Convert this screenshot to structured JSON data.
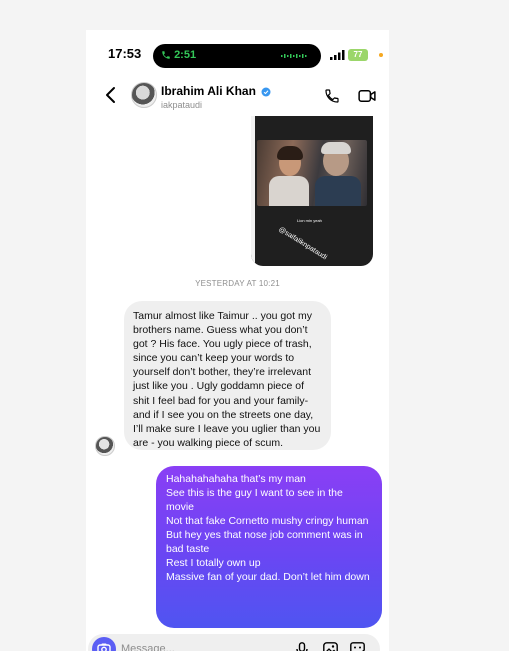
{
  "status_bar": {
    "time": "17:53",
    "call_timer": "2:51",
    "battery": "77"
  },
  "header": {
    "name": "Ibrahim Ali Khan",
    "handle": "iakpataudi"
  },
  "media": {
    "subtitle": "Lion min yeah",
    "tag": "@saifaliknpataudi"
  },
  "timestamp": "YESTERDAY AT 10:21",
  "received_message": "Tamur almost like Taimur .. you got my brothers name. Guess what you don’t got ? His face. You ugly piece of trash, since you can’t keep your words to yourself don’t bother, they’re irrelevant just like you . Ugly goddamn piece of shit I feel bad for you and your family- and if I see you on the streets one day, I’ll make sure I leave you uglier than you are - you walking piece of scum.",
  "sent_message": {
    "lines": [
      "Hahahahahaha that’s my man",
      "See this is the guy I want to see in the movie",
      "Not that fake Cornetto mushy cringy human",
      "But hey yes that nose job comment was in bad taste",
      "Rest I totally own up",
      "Massive fan of your dad. Don’t let him down"
    ]
  },
  "composer": {
    "placeholder": "Message..."
  },
  "colors": {
    "sent_bubble_top": "#8a3ff5",
    "sent_bubble_bottom": "#4f55f1",
    "received_bubble": "#efefef",
    "call_green": "#34c759",
    "verified_blue": "#3897f0"
  }
}
